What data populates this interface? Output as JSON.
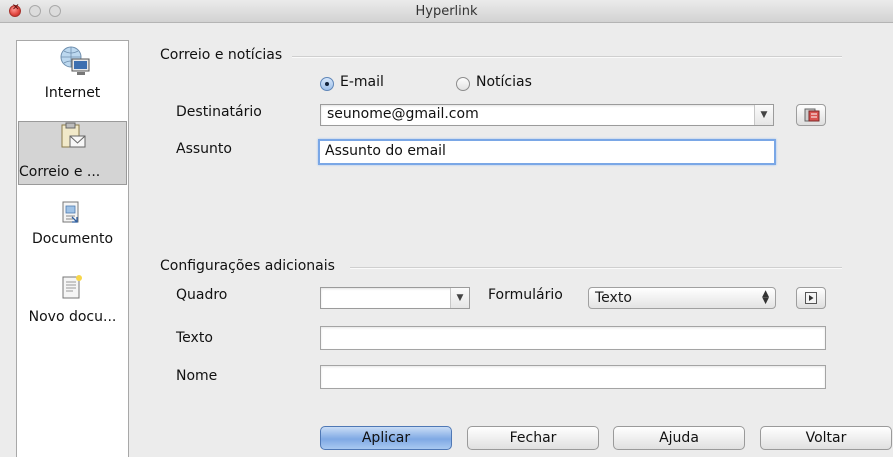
{
  "window": {
    "title": "Hyperlink"
  },
  "sidebar": {
    "items": [
      {
        "label": "Internet",
        "icon": "internet-globe-icon"
      },
      {
        "label": "Correio e ...",
        "icon": "mail-clipboard-icon",
        "selected": true
      },
      {
        "label": "Documento",
        "icon": "document-icon"
      },
      {
        "label": "Novo docu...",
        "icon": "new-document-icon"
      }
    ]
  },
  "mail_section": {
    "title": "Correio e notícias",
    "radio_email": "E-mail",
    "radio_news": "Notícias",
    "selected": "E-mail",
    "recipient_label": "Destinatário",
    "recipient_value": "seunome@gmail.com",
    "subject_label": "Assunto",
    "subject_value": "Assunto do email"
  },
  "additional_section": {
    "title": "Configurações adicionais",
    "frame_label": "Quadro",
    "frame_value": "",
    "form_label": "Formulário",
    "form_value": "Texto",
    "text_label": "Texto",
    "text_value": "",
    "name_label": "Nome",
    "name_value": ""
  },
  "buttons": {
    "apply": "Aplicar",
    "close": "Fechar",
    "help": "Ajuda",
    "back": "Voltar"
  },
  "colors": {
    "accent": "#7fa9e4",
    "close_button": "#e0443d"
  }
}
